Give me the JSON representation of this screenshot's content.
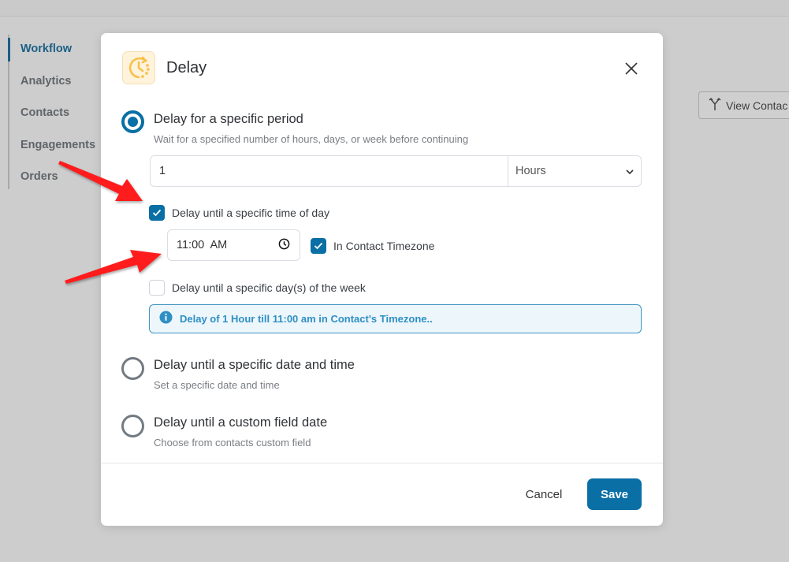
{
  "background": {
    "sidenav": {
      "items": [
        {
          "label": "Workflow",
          "active": true
        },
        {
          "label": "Analytics",
          "active": false
        },
        {
          "label": "Contacts",
          "active": false
        },
        {
          "label": "Engagements",
          "active": false
        },
        {
          "label": "Orders",
          "active": false
        }
      ]
    },
    "view_contacts_button": {
      "label": "View Contac",
      "icon": "split-arrows-icon"
    }
  },
  "modal": {
    "title": "Delay",
    "icon": "clock-delay-icon",
    "close_icon": "close-icon",
    "options": [
      {
        "title": "Delay for a specific period",
        "subtitle": "Wait for a specified number of hours, days, or week before continuing",
        "selected": true
      },
      {
        "title": "Delay until a specific date and time",
        "subtitle": "Set a specific date and time",
        "selected": false
      },
      {
        "title": "Delay until a custom field date",
        "subtitle": "Choose from contacts custom field",
        "selected": false
      }
    ],
    "period": {
      "value": "1",
      "unit": "Hours"
    },
    "time_of_day": {
      "label": "Delay until a specific time of day",
      "checked": true,
      "time_value": "11:00  AM",
      "contact_timezone": {
        "label": "In Contact Timezone",
        "checked": true
      }
    },
    "days_of_week": {
      "label": "Delay until a specific day(s) of the week",
      "checked": false
    },
    "info": {
      "text": "Delay of 1 Hour till 11:00 am in Contact's Timezone..",
      "icon": "info-icon"
    },
    "footer": {
      "cancel_label": "Cancel",
      "save_label": "Save"
    }
  },
  "colors": {
    "primary": "#0a6fa5",
    "info_text": "#2e8fc4",
    "annotation_arrow": "#ff1a1a"
  }
}
